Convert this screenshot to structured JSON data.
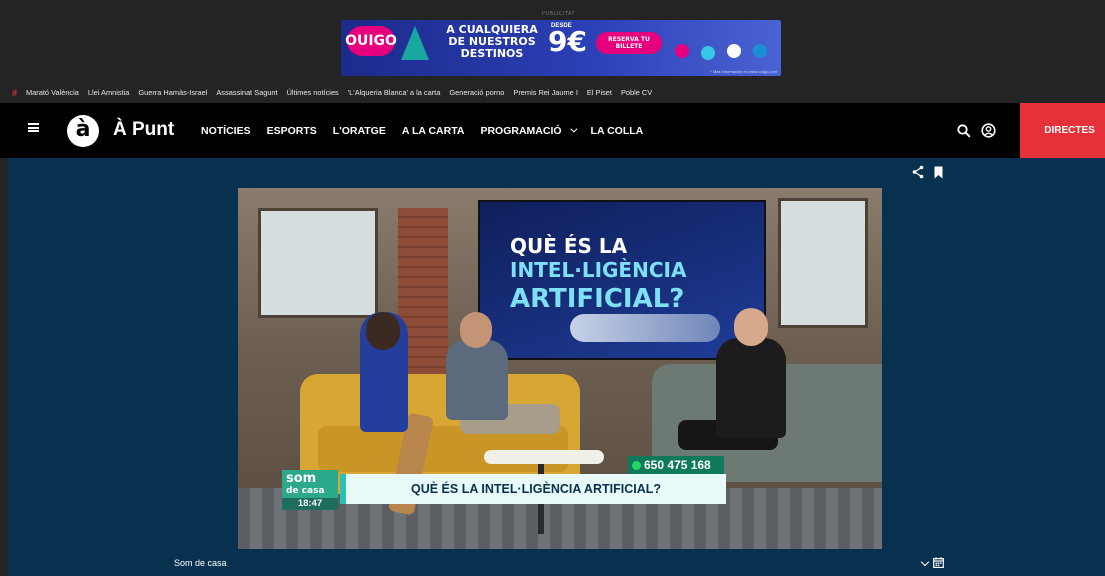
{
  "ad": {
    "label": "PUBLICITAT",
    "brand": "OUIGO",
    "headline": "A CUALQUIERA DE NUESTROS DESTINOS",
    "desde": "DESDE",
    "price": "9€",
    "cta": "RESERVA TU BILLETE",
    "fineprint": "* Más información en www.ouigo.com",
    "colors": {
      "bg": "#1c2a8a",
      "pink": "#e6007e",
      "teal": "#19a7a2"
    }
  },
  "topics": [
    "Marató València",
    "Llei Amnistia",
    "Guerra Hamàs-Israel",
    "Assassinat Sagunt",
    "Últimes notícies",
    "'L'Alqueria Blanca' a la carta",
    "Generació porno",
    "Premis Rei Jaume I",
    "El Piset",
    "Poble CV"
  ],
  "nav": {
    "logo_glyph": "à",
    "brand": "À Punt",
    "items": [
      "NOTÍCIES",
      "ESPORTS",
      "L'ORATGE",
      "A LA CARTA",
      "PROGRAMACIÓ",
      "LA COLLA"
    ],
    "directes": "DIRECTES",
    "accent": "#e5323a"
  },
  "player": {
    "tv_line1": "QUÈ ÉS LA",
    "tv_line2": "INTEL·LIGÈNCIA",
    "tv_line3": "ARTIFICIAL?",
    "phone": "650 475 168",
    "caption": "QUÈ ÉS LA INTEL·LIGÈNCIA ARTIFICIAL?",
    "show_logo_line1": "som",
    "show_logo_line2": "de casa",
    "time": "18:47",
    "bar_color": "#07314f"
  },
  "bottom": {
    "program": "Som de casa"
  }
}
